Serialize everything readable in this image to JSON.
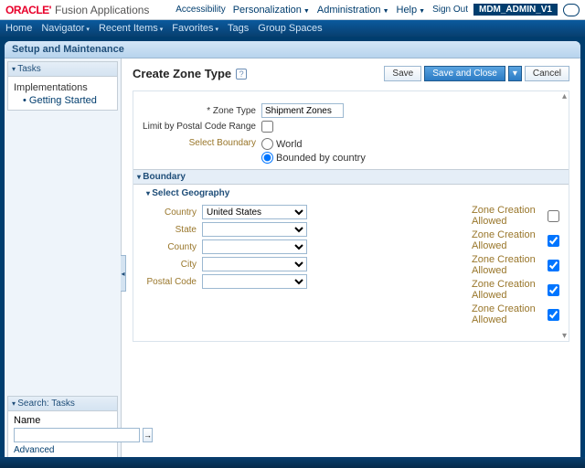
{
  "brand": {
    "oracle": "ORACLE'",
    "suite": "Fusion Applications"
  },
  "toplinks": {
    "accessibility": "Accessibility",
    "personalization": "Personalization",
    "administration": "Administration",
    "help": "Help",
    "signout": "Sign Out"
  },
  "user": "MDM_ADMIN_V1",
  "nav": {
    "home": "Home",
    "navigator": "Navigator",
    "recent": "Recent Items",
    "favorites": "Favorites",
    "tags": "Tags",
    "spaces": "Group Spaces"
  },
  "app_title": "Setup and Maintenance",
  "sidebar": {
    "tasks_title": "Tasks",
    "impl_node": "Implementations",
    "getting_started": "Getting Started",
    "search_title": "Search: Tasks",
    "name_label": "Name",
    "go": "→",
    "advanced": "Advanced"
  },
  "page": {
    "title": "Create Zone Type",
    "help": "?",
    "buttons": {
      "save": "Save",
      "save_close": "Save and Close",
      "cancel": "Cancel",
      "split": "▾"
    }
  },
  "form": {
    "zone_type_label": "* Zone Type",
    "zone_type_value": "Shipment Zones",
    "limit_label": "Limit by Postal Code Range",
    "select_boundary_label": "Select Boundary",
    "world": "World",
    "bounded": "Bounded by country",
    "boundary_section": "Boundary",
    "select_geo": "Select Geography",
    "country_label": "Country",
    "country_value": "United States",
    "state_label": "State",
    "county_label": "County",
    "city_label": "City",
    "postal_label": "Postal Code",
    "zca": "Zone Creation Allowed"
  }
}
